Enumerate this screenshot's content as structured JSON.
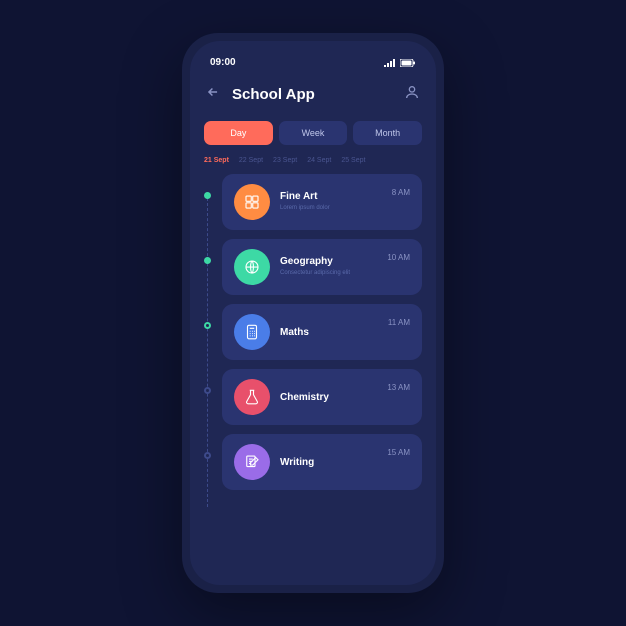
{
  "status": {
    "time": "09:00"
  },
  "header": {
    "title": "School App"
  },
  "tabs": [
    {
      "label": "Day",
      "active": true
    },
    {
      "label": "Week",
      "active": false
    },
    {
      "label": "Month",
      "active": false
    }
  ],
  "dates": [
    {
      "label": "21 Sept",
      "active": true
    },
    {
      "label": "22 Sept",
      "active": false
    },
    {
      "label": "23 Sept",
      "active": false
    },
    {
      "label": "24 Sept",
      "active": false
    },
    {
      "label": "25 Sept",
      "active": false
    }
  ],
  "classes": [
    {
      "name": "Fine Art",
      "sub": "Lorem ipsum dolor",
      "time": "8 AM",
      "icon": "palette-icon",
      "color": "ic-orange",
      "dot": "filled"
    },
    {
      "name": "Geography",
      "sub": "Consectetur adipiscing elit",
      "time": "10 AM",
      "icon": "globe-icon",
      "color": "ic-green",
      "dot": "filled"
    },
    {
      "name": "Maths",
      "sub": "",
      "time": "11 AM",
      "icon": "calculator-icon",
      "color": "ic-blue",
      "dot": "half"
    },
    {
      "name": "Chemistry",
      "sub": "",
      "time": "13 AM",
      "icon": "flask-icon",
      "color": "ic-red",
      "dot": ""
    },
    {
      "name": "Writing",
      "sub": "",
      "time": "15 AM",
      "icon": "pencil-icon",
      "color": "ic-purple",
      "dot": ""
    }
  ],
  "colors": {
    "accent": "#ff6b5b",
    "bg": "#1f2754",
    "card": "#2a3470"
  }
}
